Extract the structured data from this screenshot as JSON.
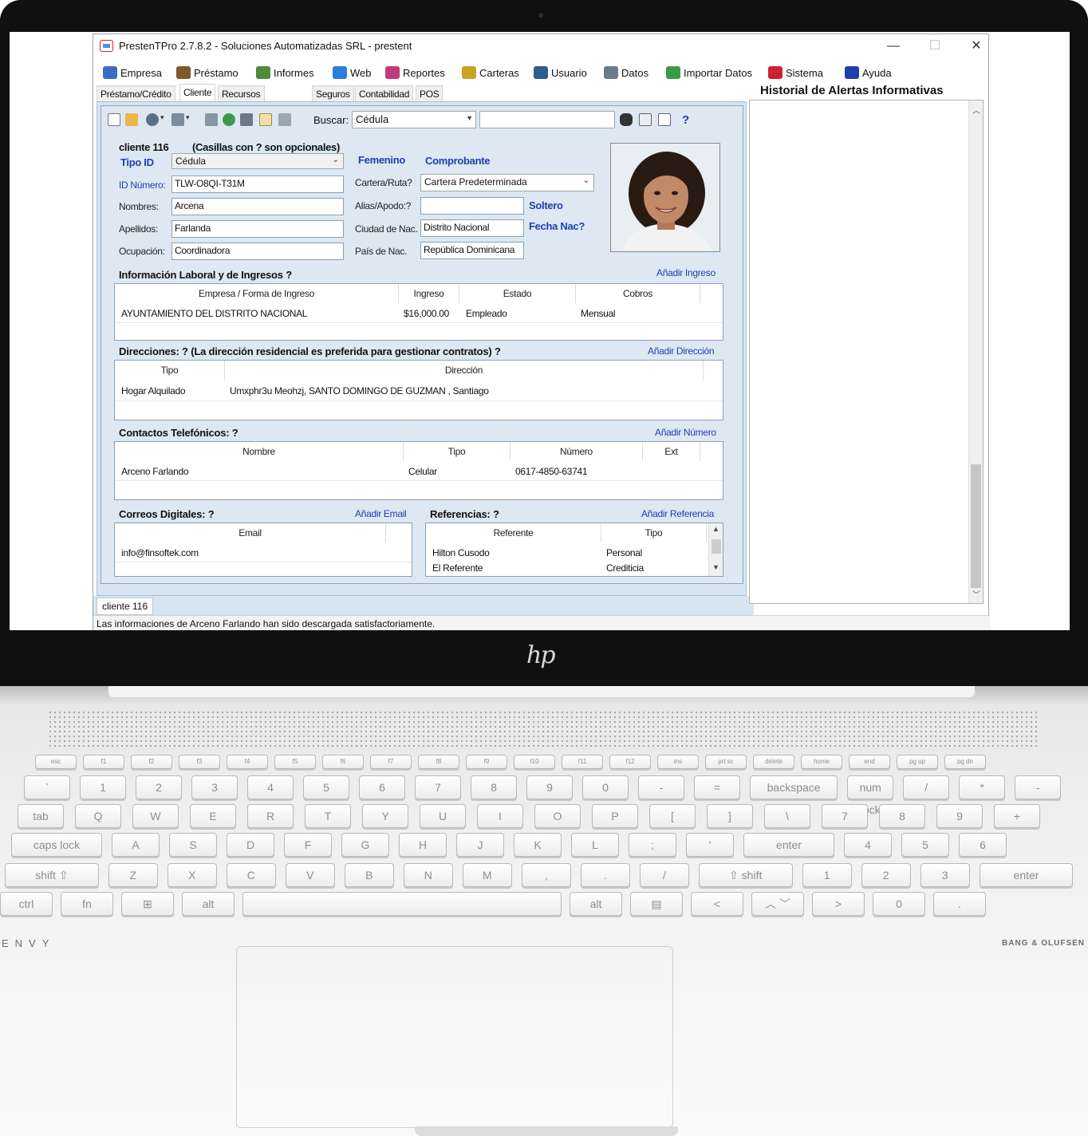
{
  "window": {
    "title": "PrestenTPro 2.7.8.2 - Soluciones Automatizadas SRL - prestent",
    "minimize": "—",
    "maximize": "☐",
    "close": "✕"
  },
  "menu": [
    {
      "label": "Empresa",
      "icon": "grid-icon",
      "color": "#3b6cc7"
    },
    {
      "label": "Préstamo",
      "icon": "handshake-icon",
      "color": "#7d5a2a"
    },
    {
      "label": "Informes",
      "icon": "report-icon",
      "color": "#4d8a3a"
    },
    {
      "label": "Web",
      "icon": "globe-icon",
      "color": "#2b7fd8"
    },
    {
      "label": "Reportes",
      "icon": "people-icon",
      "color": "#c03a7d"
    },
    {
      "label": "Carteras",
      "icon": "group-icon",
      "color": "#c8a322"
    },
    {
      "label": "Usuario",
      "icon": "user-icon",
      "color": "#2d5e8f"
    },
    {
      "label": "Datos",
      "icon": "contacts-icon",
      "color": "#6a7b8c"
    },
    {
      "label": "Importar Datos",
      "icon": "import-icon",
      "color": "#3b9a4a"
    },
    {
      "label": "Sistema",
      "icon": "app-icon",
      "color": "#c23"
    },
    {
      "label": "Ayuda",
      "icon": "help-icon",
      "color": "#1f3fae"
    }
  ],
  "tabs": [
    "Préstamo/Crédito",
    "Cliente",
    "Recursos Humanos",
    "Seguros",
    "Contabilidad",
    "POS"
  ],
  "toolbar": {
    "search_label": "Buscar:",
    "search_by": "Cédula",
    "search_value": "",
    "help_glyph": "?"
  },
  "client": {
    "header": "cliente 116",
    "optional_note": "(Casillas con ? son opcionales)",
    "id_type_label": "Tipo ID",
    "id_type": "Cédula",
    "id_number_label": "ID Número:",
    "id_number": "TLW-O8QI-T31M",
    "names_label": "Nombres:",
    "names": "Arcena",
    "surnames_label": "Apellidos:",
    "surnames": "Farlanda",
    "occupation_label": "Ocupación:",
    "occupation": "Coordinadora",
    "gender": "Femenino",
    "voucher": "Comprobante",
    "portfolio_label": "Cartera/Ruta?",
    "portfolio": "Cartera Predeterminada",
    "alias_label": "Alias/Apodo:?",
    "alias": "",
    "civil_status": "Soltero",
    "birth_city_label": "Ciudad de Nac.",
    "birth_city": "Distrito Nacional",
    "birth_date_label": "Fecha Nac?",
    "birth_country_label": "País de Nac.",
    "birth_country": "República Dominicana"
  },
  "income": {
    "title": "Información Laboral y de Ingresos ?",
    "add_link": "Añadir Ingreso",
    "columns": [
      "Empresa / Forma de Ingreso",
      "Ingreso",
      "Estado",
      "Cobros"
    ],
    "rows": [
      [
        "AYUNTAMIENTO DEL DISTRITO NACIONAL",
        "$16,000.00",
        "Empleado",
        "Mensual"
      ]
    ]
  },
  "addresses": {
    "title": "Direcciones: ? (La dirección residencial es preferida para gestionar contratos) ?",
    "add_link": "Añadir Dirección",
    "columns": [
      "Tipo",
      "Dirección"
    ],
    "rows": [
      [
        "Hogar Alquilado",
        "Umxphr3u Meohzj, SANTO DOMINGO DE GUZMAN , Santiago"
      ]
    ]
  },
  "phones": {
    "title": "Contactos Telefónicos: ?",
    "add_link": "Añadir Número",
    "columns": [
      "Nombre",
      "Tipo",
      "Número",
      "Ext"
    ],
    "rows": [
      [
        "Arceno Farlando",
        "Celular",
        "0617-4850-63741",
        ""
      ]
    ]
  },
  "emails": {
    "title": "Correos Digitales: ?",
    "add_link": "Añadir Email",
    "columns": [
      "Email"
    ],
    "rows": [
      [
        "info@finsoftek.com"
      ]
    ]
  },
  "references": {
    "title": "Referencias: ?",
    "add_link": "Añadir Referencia",
    "columns": [
      "Referente",
      "Tipo"
    ],
    "rows": [
      [
        "Hilton Cusodo",
        "Personal"
      ],
      [
        "El Referente",
        "Crediticia"
      ]
    ]
  },
  "bottom_tab": "cliente 116",
  "status": "Las informaciones de Arceno Farlando han sido descargada satisfactoriamente.",
  "alerts": {
    "title": "Historial de Alertas Informativas"
  },
  "laptop": {
    "logo": "hp",
    "deck_brand_left": "ENVY",
    "deck_brand_right": "BANG & OLUFSEN"
  },
  "keyboard": {
    "row0": [
      "esc",
      "f1",
      "f2",
      "f3",
      "f4",
      "f5",
      "f6",
      "f7",
      "f8",
      "f9",
      "f10",
      "f11",
      "f12",
      "ins",
      "prt sc",
      "delete",
      "home",
      "end",
      "pg up",
      "pg dn"
    ],
    "row1": [
      "`",
      "1",
      "2",
      "3",
      "4",
      "5",
      "6",
      "7",
      "8",
      "9",
      "0",
      "-",
      "=",
      "backspace",
      "num lock",
      "/",
      "*",
      "-"
    ],
    "row2": [
      "tab",
      "Q",
      "W",
      "E",
      "R",
      "T",
      "Y",
      "U",
      "I",
      "O",
      "P",
      "[",
      "]",
      "\\",
      "7",
      "8",
      "9",
      "+"
    ],
    "row3": [
      "caps lock",
      "A",
      "S",
      "D",
      "F",
      "G",
      "H",
      "J",
      "K",
      "L",
      ";",
      "'",
      "enter",
      "4",
      "5",
      "6"
    ],
    "row4": [
      "shift ⇧",
      "Z",
      "X",
      "C",
      "V",
      "B",
      "N",
      "M",
      ",",
      ".",
      "/",
      "⇧ shift",
      "1",
      "2",
      "3",
      "enter"
    ],
    "row5": [
      "ctrl",
      "fn",
      "⊞",
      "alt",
      "",
      "alt",
      "▤",
      "<",
      "︿ ﹀",
      ">",
      "0",
      "."
    ]
  }
}
